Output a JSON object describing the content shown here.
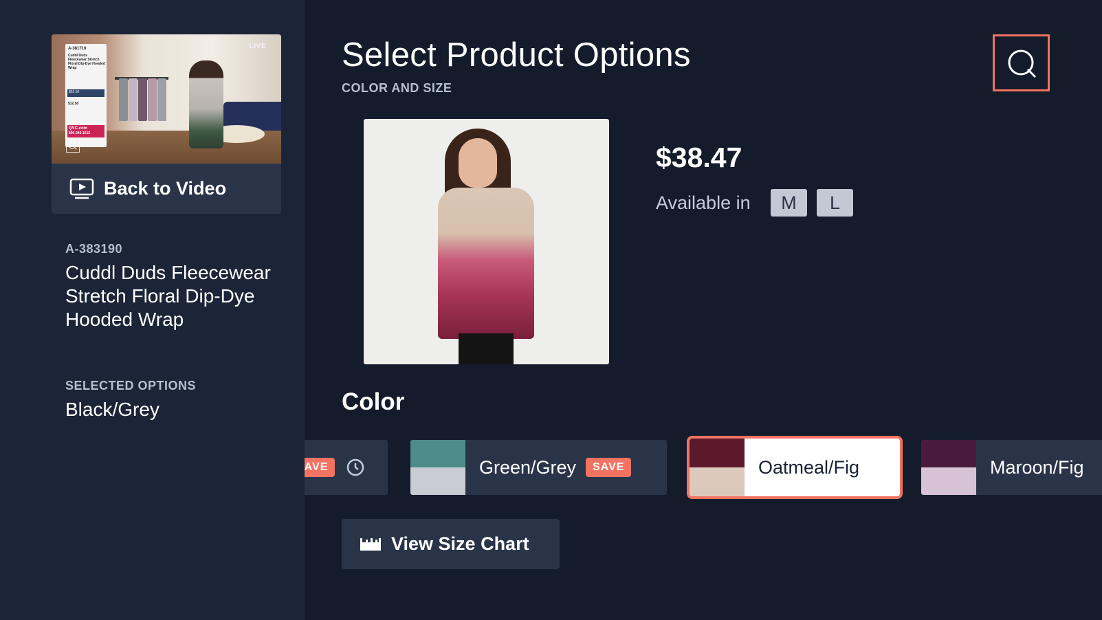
{
  "sidebar": {
    "video": {
      "live_label": "LIVE",
      "overlay_item": "A-381710",
      "overlay_name": "Cuddl Duds Fleecewear Stretch Floral Dip-Dye Hooded Wrap",
      "overlay_price": "$62.50",
      "overlay_payments": "$12.50",
      "overlay_site": "QVC.com",
      "overlay_phone": "800-345-1515"
    },
    "back_label": "Back to Video",
    "sku": "A-383190",
    "product_name": "Cuddl Duds Fleecewear Stretch Floral Dip-Dye Hooded Wrap",
    "selected_options_label": "SELECTED OPTIONS",
    "selected_options_value": "Black/Grey"
  },
  "main": {
    "title": "Select Product Options",
    "subtitle": "COLOR AND SIZE",
    "price": "$38.47",
    "available_in_label": "Available in",
    "sizes": [
      "M",
      "L"
    ],
    "color_heading": "Color",
    "colors": [
      {
        "label": "",
        "badge": "SAVE",
        "top": "#2a3449",
        "bottom": "#2a3449"
      },
      {
        "label": "Green/Grey",
        "badge": "SAVE",
        "top": "#4e8c8a",
        "bottom": "#c9ccd3"
      },
      {
        "label": "Oatmeal/Fig",
        "badge": "",
        "top": "#5a1a2c",
        "bottom": "#dcc9bc",
        "selected": true
      },
      {
        "label": "Maroon/Fig",
        "badge": "",
        "top": "#4a1a3c",
        "bottom": "#d8c2d6"
      }
    ],
    "size_chart_label": "View Size Chart"
  },
  "colors": {
    "accent": "#f27361",
    "background": "#141c2c",
    "sidebar": "#1c2537",
    "card": "#2a3449"
  }
}
